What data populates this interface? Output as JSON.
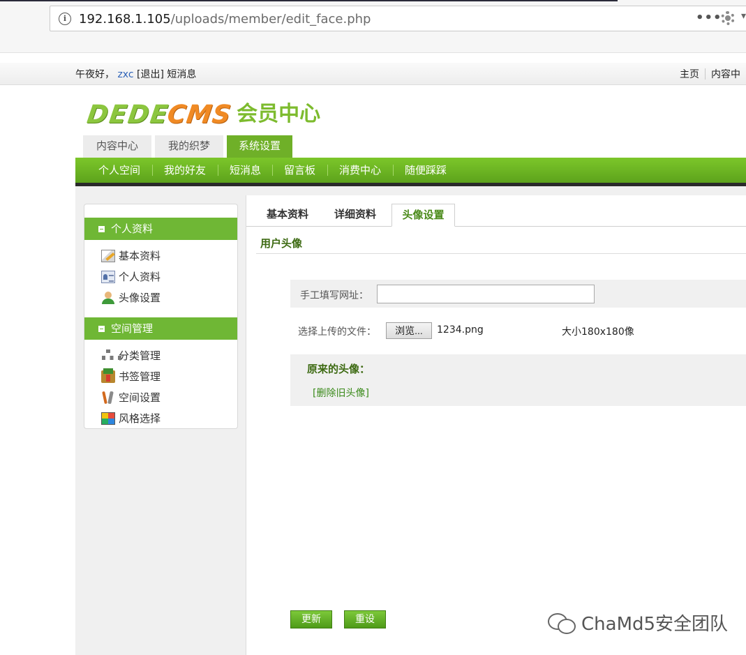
{
  "browser": {
    "url_host": "192.168.1.105",
    "url_path": "/uploads/member/edit_face.php",
    "menu_icon": "•••"
  },
  "topbar": {
    "greeting": "午夜好，",
    "username": "zxc",
    "logout": "[退出]",
    "messages": "短消息",
    "links": [
      "主页",
      "内容中"
    ]
  },
  "logo": {
    "part1": "DEDE",
    "part2": "CMS",
    "suffix": "会员中心"
  },
  "main_tabs": [
    {
      "label": "内容中心",
      "active": false
    },
    {
      "label": "我的织梦",
      "active": false
    },
    {
      "label": "系统设置",
      "active": true
    }
  ],
  "sub_nav": [
    "个人空间",
    "我的好友",
    "短消息",
    "留言板",
    "消费中心",
    "随便踩踩"
  ],
  "sidebar": {
    "section1": {
      "title": "个人资料",
      "items": [
        {
          "label": "基本资料",
          "icon": "pencil-icon"
        },
        {
          "label": "个人资料",
          "icon": "id-card-icon"
        },
        {
          "label": "头像设置",
          "icon": "user-icon"
        }
      ]
    },
    "section2": {
      "title": "空间管理",
      "items": [
        {
          "label": "分类管理",
          "icon": "tree-icon"
        },
        {
          "label": "书签管理",
          "icon": "bookmark-icon"
        },
        {
          "label": "空间设置",
          "icon": "tools-icon"
        },
        {
          "label": "风格选择",
          "icon": "palette-icon"
        }
      ]
    }
  },
  "panel": {
    "tabs": [
      {
        "label": "基本资料",
        "active": false
      },
      {
        "label": "详细资料",
        "active": false
      },
      {
        "label": "头像设置",
        "active": true
      }
    ],
    "section_title": "用户头像",
    "manual_url_label": "手工填写网址：",
    "manual_url_value": "",
    "upload_label": "选择上传的文件：",
    "browse_label": "浏览...",
    "file_name": "1234.png",
    "size_hint": "大小180x180像",
    "old_avatar_title": "原来的头像：",
    "delete_old": "[删除旧头像]",
    "submit_label": "更新",
    "reset_label": "重设"
  },
  "watermark": "ChaMd5安全团队",
  "colors": {
    "green": "#6fb028",
    "dark_green_text": "#3d6a12",
    "orange": "#f08a24",
    "link_blue": "#2e63b8"
  }
}
